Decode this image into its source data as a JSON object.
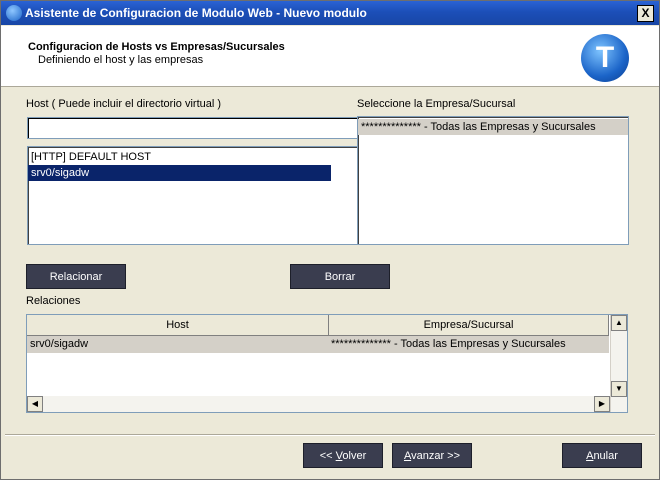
{
  "window": {
    "title": "Asistente de Configuracion de Modulo Web - Nuevo modulo",
    "close_glyph": "X"
  },
  "header": {
    "title": "Configuracion de Hosts vs Empresas/Sucursales",
    "subtitle": "Definiendo el host y las empresas",
    "logo_letter": "T"
  },
  "host": {
    "label": "Host ( Puede incluir el directorio virtual )",
    "input_value": "",
    "items": [
      {
        "label": "[HTTP] DEFAULT HOST",
        "selected": false
      },
      {
        "label": "srv0/sigadw",
        "selected": true
      }
    ]
  },
  "empresa": {
    "label": "Seleccione la Empresa/Sucursal",
    "items": [
      {
        "label": "************** - Todas las Empresas y Sucursales"
      }
    ]
  },
  "buttons": {
    "relacionar": "Relacionar",
    "borrar": "Borrar",
    "volver_prefix": "<< ",
    "volver_key": "V",
    "volver_rest": "olver",
    "avanzar_key": "A",
    "avanzar_rest": "vanzar >>",
    "anular_key": "A",
    "anular_rest": "nular"
  },
  "relaciones": {
    "label": "Relaciones",
    "columns": [
      "Host",
      "Empresa/Sucursal"
    ],
    "rows": [
      [
        "srv0/sigadw",
        "************** - Todas las Empresas y Sucursales"
      ]
    ]
  },
  "icons": {
    "scroll_up": "▲",
    "scroll_down": "▼",
    "scroll_left": "◀",
    "scroll_right": "▶"
  }
}
